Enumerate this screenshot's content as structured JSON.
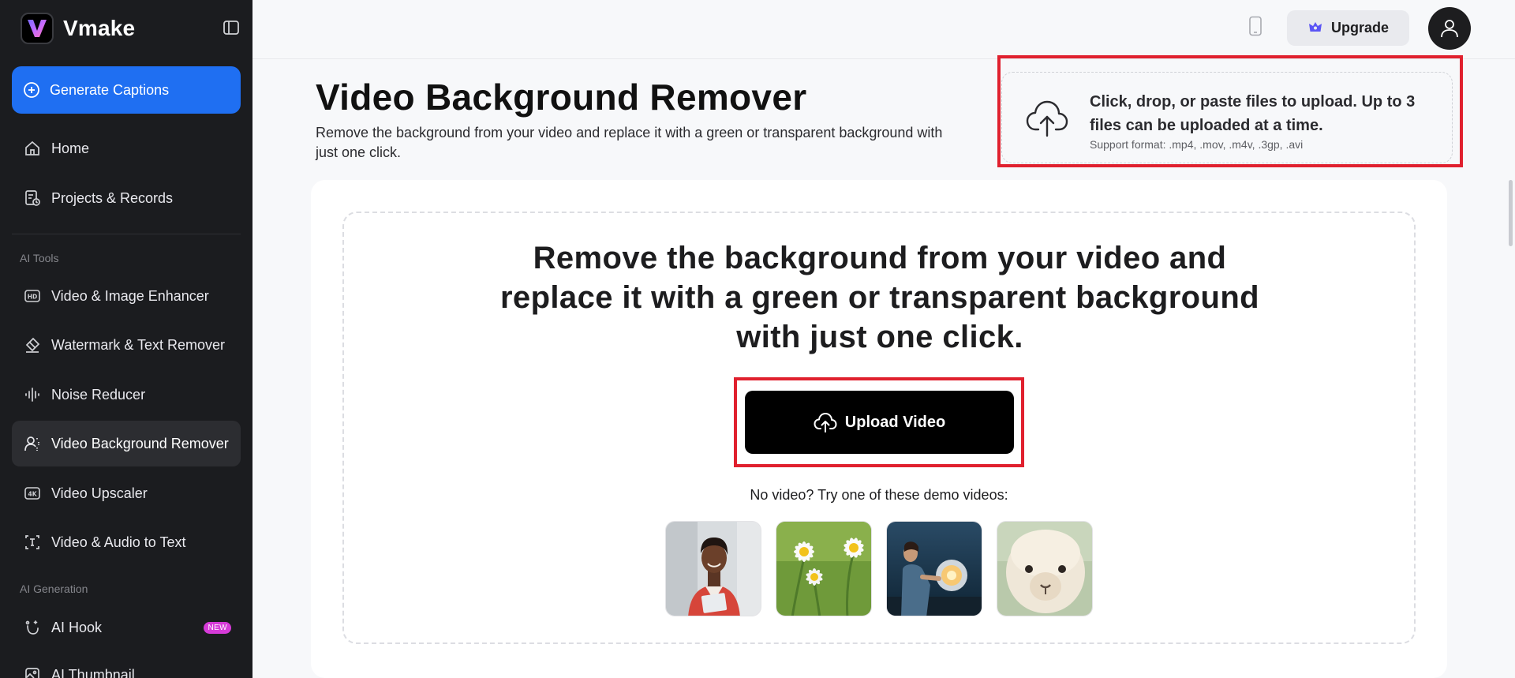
{
  "app": {
    "name": "Vmake"
  },
  "sidebar": {
    "generate_label": "Generate Captions",
    "items": [
      {
        "label": "Home",
        "icon": "home-icon"
      },
      {
        "label": "Projects & Records",
        "icon": "projects-icon"
      }
    ],
    "section_ai_tools": "AI Tools",
    "tools": [
      {
        "label": "Video & Image Enhancer",
        "icon": "hd-icon"
      },
      {
        "label": "Watermark & Text Remover",
        "icon": "eraser-icon"
      },
      {
        "label": "Noise Reducer",
        "icon": "noise-icon"
      },
      {
        "label": "Video Background Remover",
        "icon": "person-remove-icon",
        "active": true
      },
      {
        "label": "Video Upscaler",
        "icon": "4k-icon"
      },
      {
        "label": "Video & Audio to Text",
        "icon": "text-icon"
      }
    ],
    "section_ai_generation": "AI Generation",
    "generation": [
      {
        "label": "AI Hook",
        "icon": "magic-icon",
        "badge": "NEW"
      },
      {
        "label": "AI Thumbnail",
        "icon": "thumbnail-icon"
      }
    ]
  },
  "topbar": {
    "upgrade_label": "Upgrade"
  },
  "header": {
    "title": "Video Background Remover",
    "subtitle": "Remove the background from your video and replace it with a green or transparent background with just one click."
  },
  "quick_upload": {
    "main": "Click, drop, or paste files to upload. Up to 3 files can be uploaded at a time.",
    "formats": "Support format: .mp4, .mov, .m4v, .3gp, .avi"
  },
  "main": {
    "headline": "Remove the background from your video and replace it with a green or transparent background with just one click.",
    "upload_label": "Upload Video",
    "demo_label": "No video? Try one of these demo videos:",
    "demos": [
      "woman-with-laptop",
      "daisies",
      "astronaut-helmet",
      "alpaca"
    ]
  },
  "colors": {
    "accent": "#1f6ff2",
    "sidebar_bg": "#1b1c1f",
    "highlight": "#e0202e",
    "badge": "#d63bd8"
  }
}
